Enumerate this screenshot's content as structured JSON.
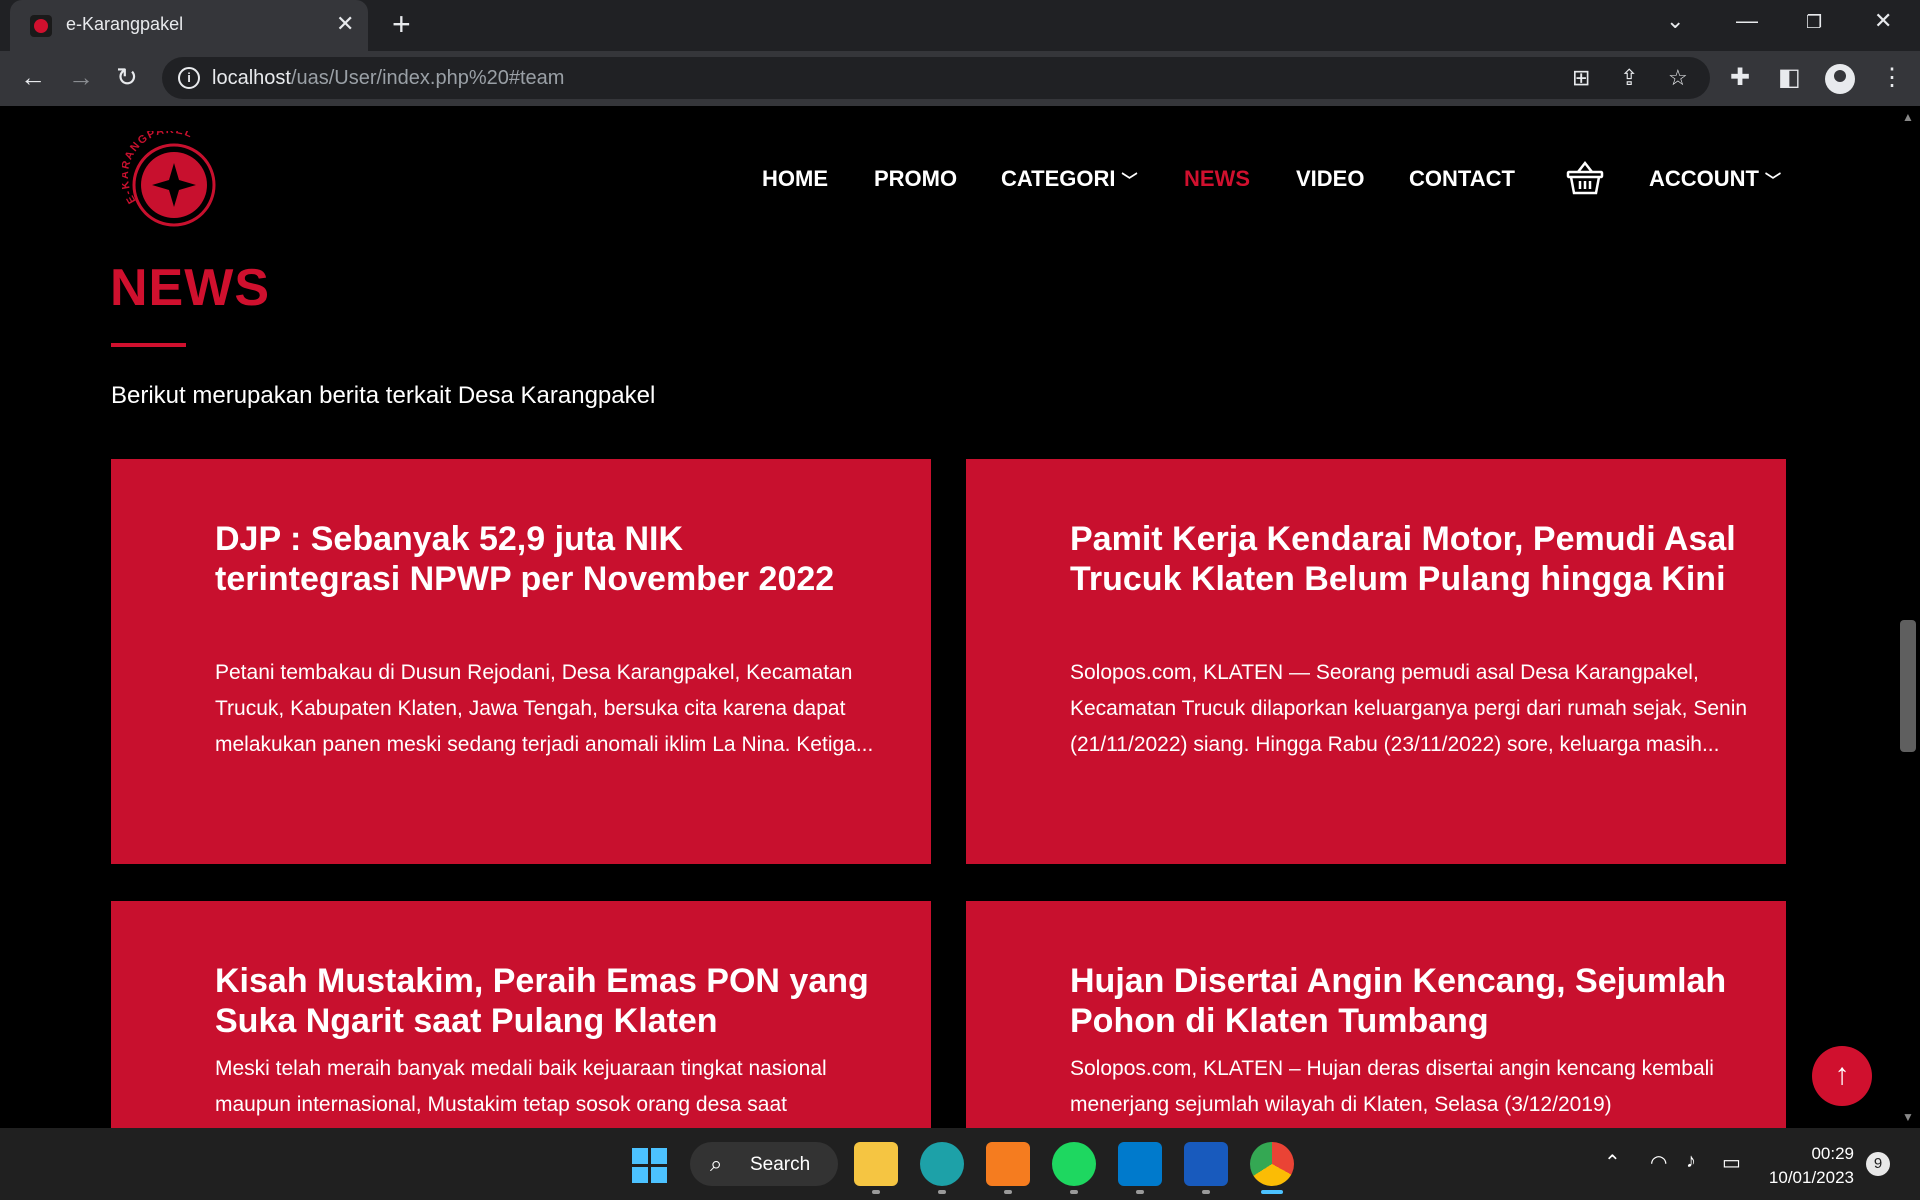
{
  "browser": {
    "tab_title": "e-Karangpakel",
    "url_host": "localhost",
    "url_path": "/uas/User/index.php%20#team"
  },
  "site": {
    "logo_text": "E-KARANGPAKEL",
    "nav": {
      "home": "HOME",
      "promo": "PROMO",
      "categori": "CATEGORI",
      "news": "NEWS",
      "video": "VIDEO",
      "contact": "CONTACT",
      "account": "ACCOUNT"
    }
  },
  "news": {
    "title": "NEWS",
    "subtitle": "Berikut merupakan berita terkait Desa Karangpakel",
    "cards": [
      {
        "title": "DJP : Sebanyak 52,9 juta NIK terintegrasi NPWP per November 2022",
        "text": "Petani tembakau di Dusun Rejodani, Desa Karangpakel, Kecamatan Trucuk, Kabupaten Klaten, Jawa Tengah, bersuka cita karena dapat melakukan panen meski sedang terjadi anomali iklim La Nina. Ketiga..."
      },
      {
        "title": "Pamit Kerja Kendarai Motor, Pemudi Asal Trucuk Klaten Belum Pulang hingga Kini",
        "text": "Solopos.com, KLATEN — Seorang pemudi asal Desa Karangpakel, Kecamatan Trucuk dilaporkan keluarganya pergi dari rumah sejak, Senin (21/11/2022) siang. Hingga Rabu (23/11/2022) sore, keluarga masih..."
      },
      {
        "title": "Kisah Mustakim, Peraih Emas PON yang Suka Ngarit saat Pulang Klaten",
        "text": "Meski telah meraih banyak medali baik kejuaraan tingkat nasional maupun internasional, Mustakim tetap sosok orang desa saat"
      },
      {
        "title": "Hujan Disertai Angin Kencang, Sejumlah Pohon di Klaten Tumbang",
        "text": "Solopos.com, KLATEN – Hujan deras disertai angin kencang kembali menerjang sejumlah wilayah di Klaten, Selasa (3/12/2019)"
      }
    ]
  },
  "taskbar": {
    "search_label": "Search",
    "time": "00:29",
    "date": "10/01/2023",
    "notifications": "9"
  },
  "colors": {
    "accent": "#c8102e",
    "background": "#000000"
  }
}
